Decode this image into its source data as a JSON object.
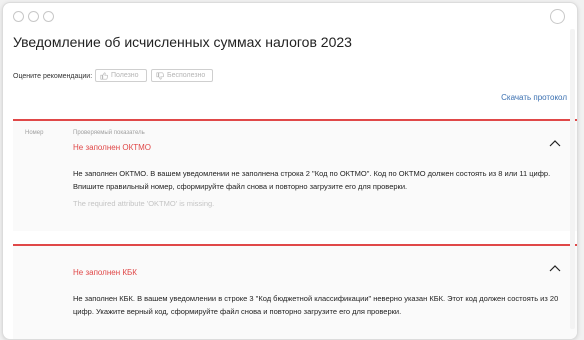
{
  "page": {
    "title": "Уведомление об исчисленных суммах налогов 2023",
    "rate_label": "Оцените рекомендации:",
    "useful_label": "Полезно",
    "not_useful_label": "Бесполезно",
    "download_label": "Скачать протокол"
  },
  "columns": {
    "number": "Номер",
    "indicator": "Проверяемый показатель"
  },
  "errors": [
    {
      "title": "Не заполнен ОКТМО",
      "description": "Не заполнен ОКТМО. В вашем уведомлении не заполнена строка 2 \"Код по ОКТМО\". Код по ОКТМО должен состоять из 8 или 11 цифр. Впишите правильный номер, сформируйте файл снова и повторно загрузите его для проверки.",
      "technical": "The required attribute 'OKTMO' is missing."
    },
    {
      "title": "Не заполнен КБК",
      "description": "Не заполнен КБК. В вашем уведомлении в строке 3 \"Код бюджетной классификации\" неверно указан КБК. Этот код должен состоять из 20 цифр. Укажите верный код, сформируйте файл снова и повторно загрузите его для проверки."
    }
  ],
  "colors": {
    "accent_red": "#e04848",
    "link_blue": "#3a6fb0"
  }
}
